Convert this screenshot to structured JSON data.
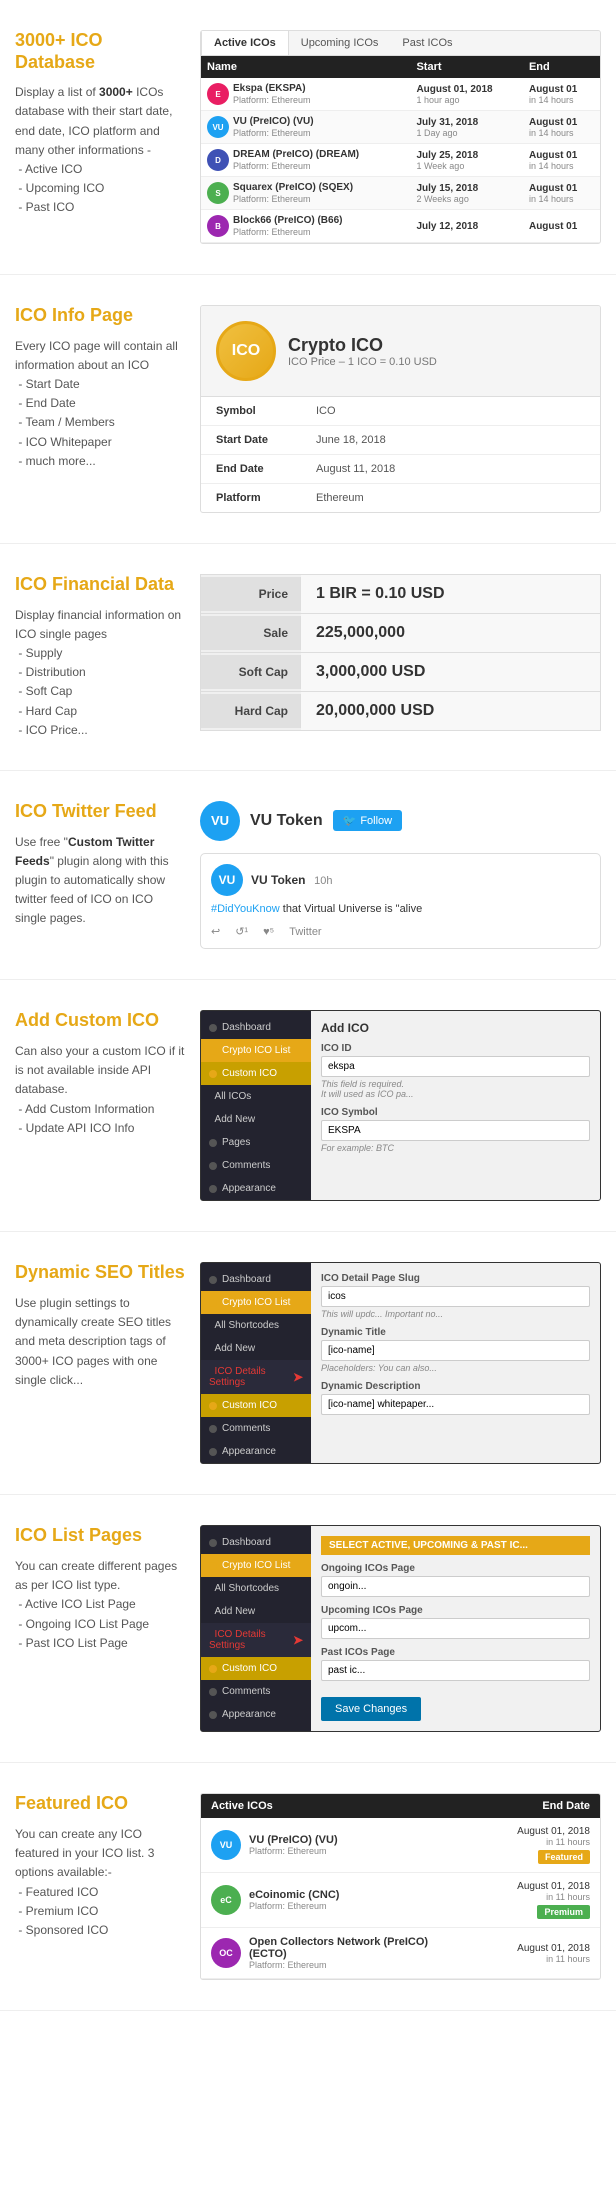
{
  "sections": {
    "database": {
      "title": "3000+ ICO Database",
      "desc": "Display a list of 3000+ ICOs database with their start date, end date, ICO platform and many other informations -\n - Active ICO\n - Upcoming ICO\n - Past ICO",
      "tabs": [
        "Active ICOs",
        "Upcoming ICOs",
        "Past ICOs"
      ],
      "table_headers": [
        "Name",
        "Start",
        "End"
      ],
      "rows": [
        {
          "name": "Ekspa (EKSPA)",
          "platform": "Platform: Ethereum",
          "color": "#e91e63",
          "initials": "E",
          "start": "August 01, 2018",
          "start_ago": "1 hour ago",
          "end": "August 01",
          "end_in": "in 14 hours"
        },
        {
          "name": "VU (PreICO) (VU)",
          "platform": "Platform: Ethereum",
          "color": "#1da1f2",
          "initials": "VU",
          "start": "July 31, 2018",
          "start_ago": "1 Day ago",
          "end": "August 01",
          "end_in": "in 14 hours"
        },
        {
          "name": "DREAM (PreICO) (DREAM)",
          "platform": "Platform: Ethereum",
          "color": "#3f51b5",
          "initials": "D",
          "start": "July 25, 2018",
          "start_ago": "1 Week ago",
          "end": "August 01",
          "end_in": "in 14 hours"
        },
        {
          "name": "Squarex (PreICO) (SQEX)",
          "platform": "Platform: Ethereum",
          "color": "#4caf50",
          "initials": "S",
          "start": "July 15, 2018",
          "start_ago": "2 Weeks ago",
          "end": "August 01",
          "end_in": "in 14 hours"
        },
        {
          "name": "Block66 (PreICO) (B66)",
          "platform": "Platform: Ethereum",
          "color": "#9c27b0",
          "initials": "B",
          "start": "July 12, 2018",
          "start_ago": "",
          "end": "August 01",
          "end_in": ""
        }
      ]
    },
    "info": {
      "title": "ICO Info Page",
      "desc": "Every ICO page will contain all information about an ICO\n - Start Date\n - End Date\n - Team / Members\n - ICO Whitepaper\n - much more...",
      "logo_text": "ICO",
      "crypto_name": "Crypto ICO",
      "price_label": "ICO Price",
      "price_value": "1 ICO = 0.10 USD",
      "rows": [
        {
          "label": "Symbol",
          "value": "ICO"
        },
        {
          "label": "Start Date",
          "value": "June 18, 2018"
        },
        {
          "label": "End Date",
          "value": "August 11, 2018"
        },
        {
          "label": "Platform",
          "value": "Ethereum"
        }
      ]
    },
    "financial": {
      "title": "ICO Financial Data",
      "desc": "Display financial information on ICO single pages\n - Supply\n - Distribution\n - Soft Cap\n - Hard Cap\n - ICO Price...",
      "rows": [
        {
          "label": "Price",
          "value": "1 BIR = 0.10 USD"
        },
        {
          "label": "Sale",
          "value": "225,000,000"
        },
        {
          "label": "Soft Cap",
          "value": "3,000,000 USD"
        },
        {
          "label": "Hard Cap",
          "value": "20,000,000 USD"
        }
      ]
    },
    "twitter": {
      "title": "ICO Twitter Feed",
      "desc": "Use free \"Custom Twitter Feeds\" plugin along with this plugin to automatically show twitter feed of ICO on ICO single pages.",
      "brand_name": "VU Token",
      "follow_btn": "Follow",
      "tweet_author": "VU Token",
      "tweet_time": "10h",
      "tweet_text": "#DidYouKnow that Virtual Universe is \"alive",
      "tweet_actions": [
        "↩",
        "↺¹",
        "♥⁵",
        "Twitter"
      ]
    },
    "custom_ico": {
      "title": "Add Custom ICO",
      "desc": "Can also your a custom ICO if it is not available inside API database.\n - Add Custom Information\n - Update API ICO Info",
      "admin": {
        "sidebar_items": [
          {
            "label": "Dashboard",
            "active": false,
            "dot": "yellow"
          },
          {
            "label": "Crypto ICO List",
            "active": true,
            "dot": "yellow"
          },
          {
            "label": "Custom ICO",
            "active": false,
            "dot": "yellow"
          },
          {
            "label": "All ICOs",
            "active": false,
            "dot": null
          },
          {
            "label": "Add New",
            "active": false,
            "dot": null
          },
          {
            "label": "Pages",
            "active": false,
            "dot": "page"
          },
          {
            "label": "Comments",
            "active": false,
            "dot": "comment"
          },
          {
            "label": "Appearance",
            "active": false,
            "dot": "appear"
          }
        ],
        "content_title": "Add ICO",
        "fields": [
          {
            "label": "ICO ID",
            "value": "ekspa",
            "hint": "This field is required. It will used as ICO pa..."
          },
          {
            "label": "ICO Symbol",
            "value": "EKSPA",
            "hint": "For example: BTC"
          }
        ]
      }
    },
    "seo": {
      "title": "Dynamic SEO Titles",
      "desc": "Use plugin settings to dynamically create SEO titles and meta description tags of 3000+ ICO pages with one single click...",
      "admin": {
        "sidebar_items": [
          {
            "label": "Dashboard",
            "active": false
          },
          {
            "label": "Crypto ICO List",
            "active": true
          },
          {
            "label": "All Shortcodes",
            "active": false
          },
          {
            "label": "Add New",
            "active": false
          },
          {
            "label": "ICO Details Settings",
            "active": true,
            "arrow": true
          },
          {
            "label": "Custom ICO",
            "active": false
          },
          {
            "label": "Comments",
            "active": false
          },
          {
            "label": "Appearance",
            "active": false
          }
        ],
        "content_fields": [
          {
            "label": "ICO Detail Page Slug",
            "value": "icos",
            "hint": "This will updc... Important no..."
          },
          {
            "label": "Dynamic Title",
            "value": "[ico-name]",
            "placeholder": "Placeholders: You can also..."
          },
          {
            "label": "Dynamic Description",
            "value": "[ico-name] whitepaper..."
          }
        ]
      }
    },
    "list_pages": {
      "title": "ICO List Pages",
      "desc": "You can create different pages as per ICO list type.\n - Active ICO List Page\n - Ongoing ICO List Page\n - Past ICO List Page",
      "admin": {
        "sidebar_items": [
          {
            "label": "Dashboard",
            "active": false
          },
          {
            "label": "Crypto ICO List",
            "active": true
          },
          {
            "label": "All Shortcodes",
            "active": false
          },
          {
            "label": "Add New",
            "active": false
          },
          {
            "label": "ICO Details Settings",
            "active": true,
            "arrow": true
          },
          {
            "label": "Custom ICO",
            "active": false
          },
          {
            "label": "Comments",
            "active": false
          },
          {
            "label": "Appearance",
            "active": false
          }
        ],
        "select_label": "SELECT ACTIVE, UPCOMING & PAST IC...",
        "fields": [
          {
            "label": "Ongoing ICOs Page",
            "value": "ongoin..."
          },
          {
            "label": "Upcoming ICOs Page",
            "value": "upcom..."
          },
          {
            "label": "Past ICOs Page",
            "value": "past ic..."
          }
        ],
        "save_btn": "Save Changes"
      }
    },
    "featured": {
      "title": "Featured ICO",
      "desc": "You can create any ICO featured in your ICO list. 3 options available:-\n - Featured ICO\n - Premium ICO\n - Sponsored ICO",
      "list_cols": [
        "Active ICOs",
        "End Date"
      ],
      "items": [
        {
          "name": "VU (PreICO) (VU)",
          "platform": "Platform: Ethereum",
          "color": "#1da1f2",
          "initials": "VU",
          "date": "August 01, 2018",
          "ago": "in 11 hours",
          "badge": "Featured",
          "badge_type": "featured"
        },
        {
          "name": "eCoinomic (CNC)",
          "platform": "Platform: Ethereum",
          "color": "#4caf50",
          "initials": "eC",
          "date": "August 01, 2018",
          "ago": "in 11 hours",
          "badge": "Premium",
          "badge_type": "premium"
        },
        {
          "name": "Open Collectors Network (PreICO) (ECTO)",
          "platform": "Platform: Ethereum",
          "color": "#9c27b0",
          "initials": "OC",
          "date": "August 01, 2018",
          "ago": "in 11 hours",
          "badge": "",
          "badge_type": ""
        }
      ]
    }
  }
}
